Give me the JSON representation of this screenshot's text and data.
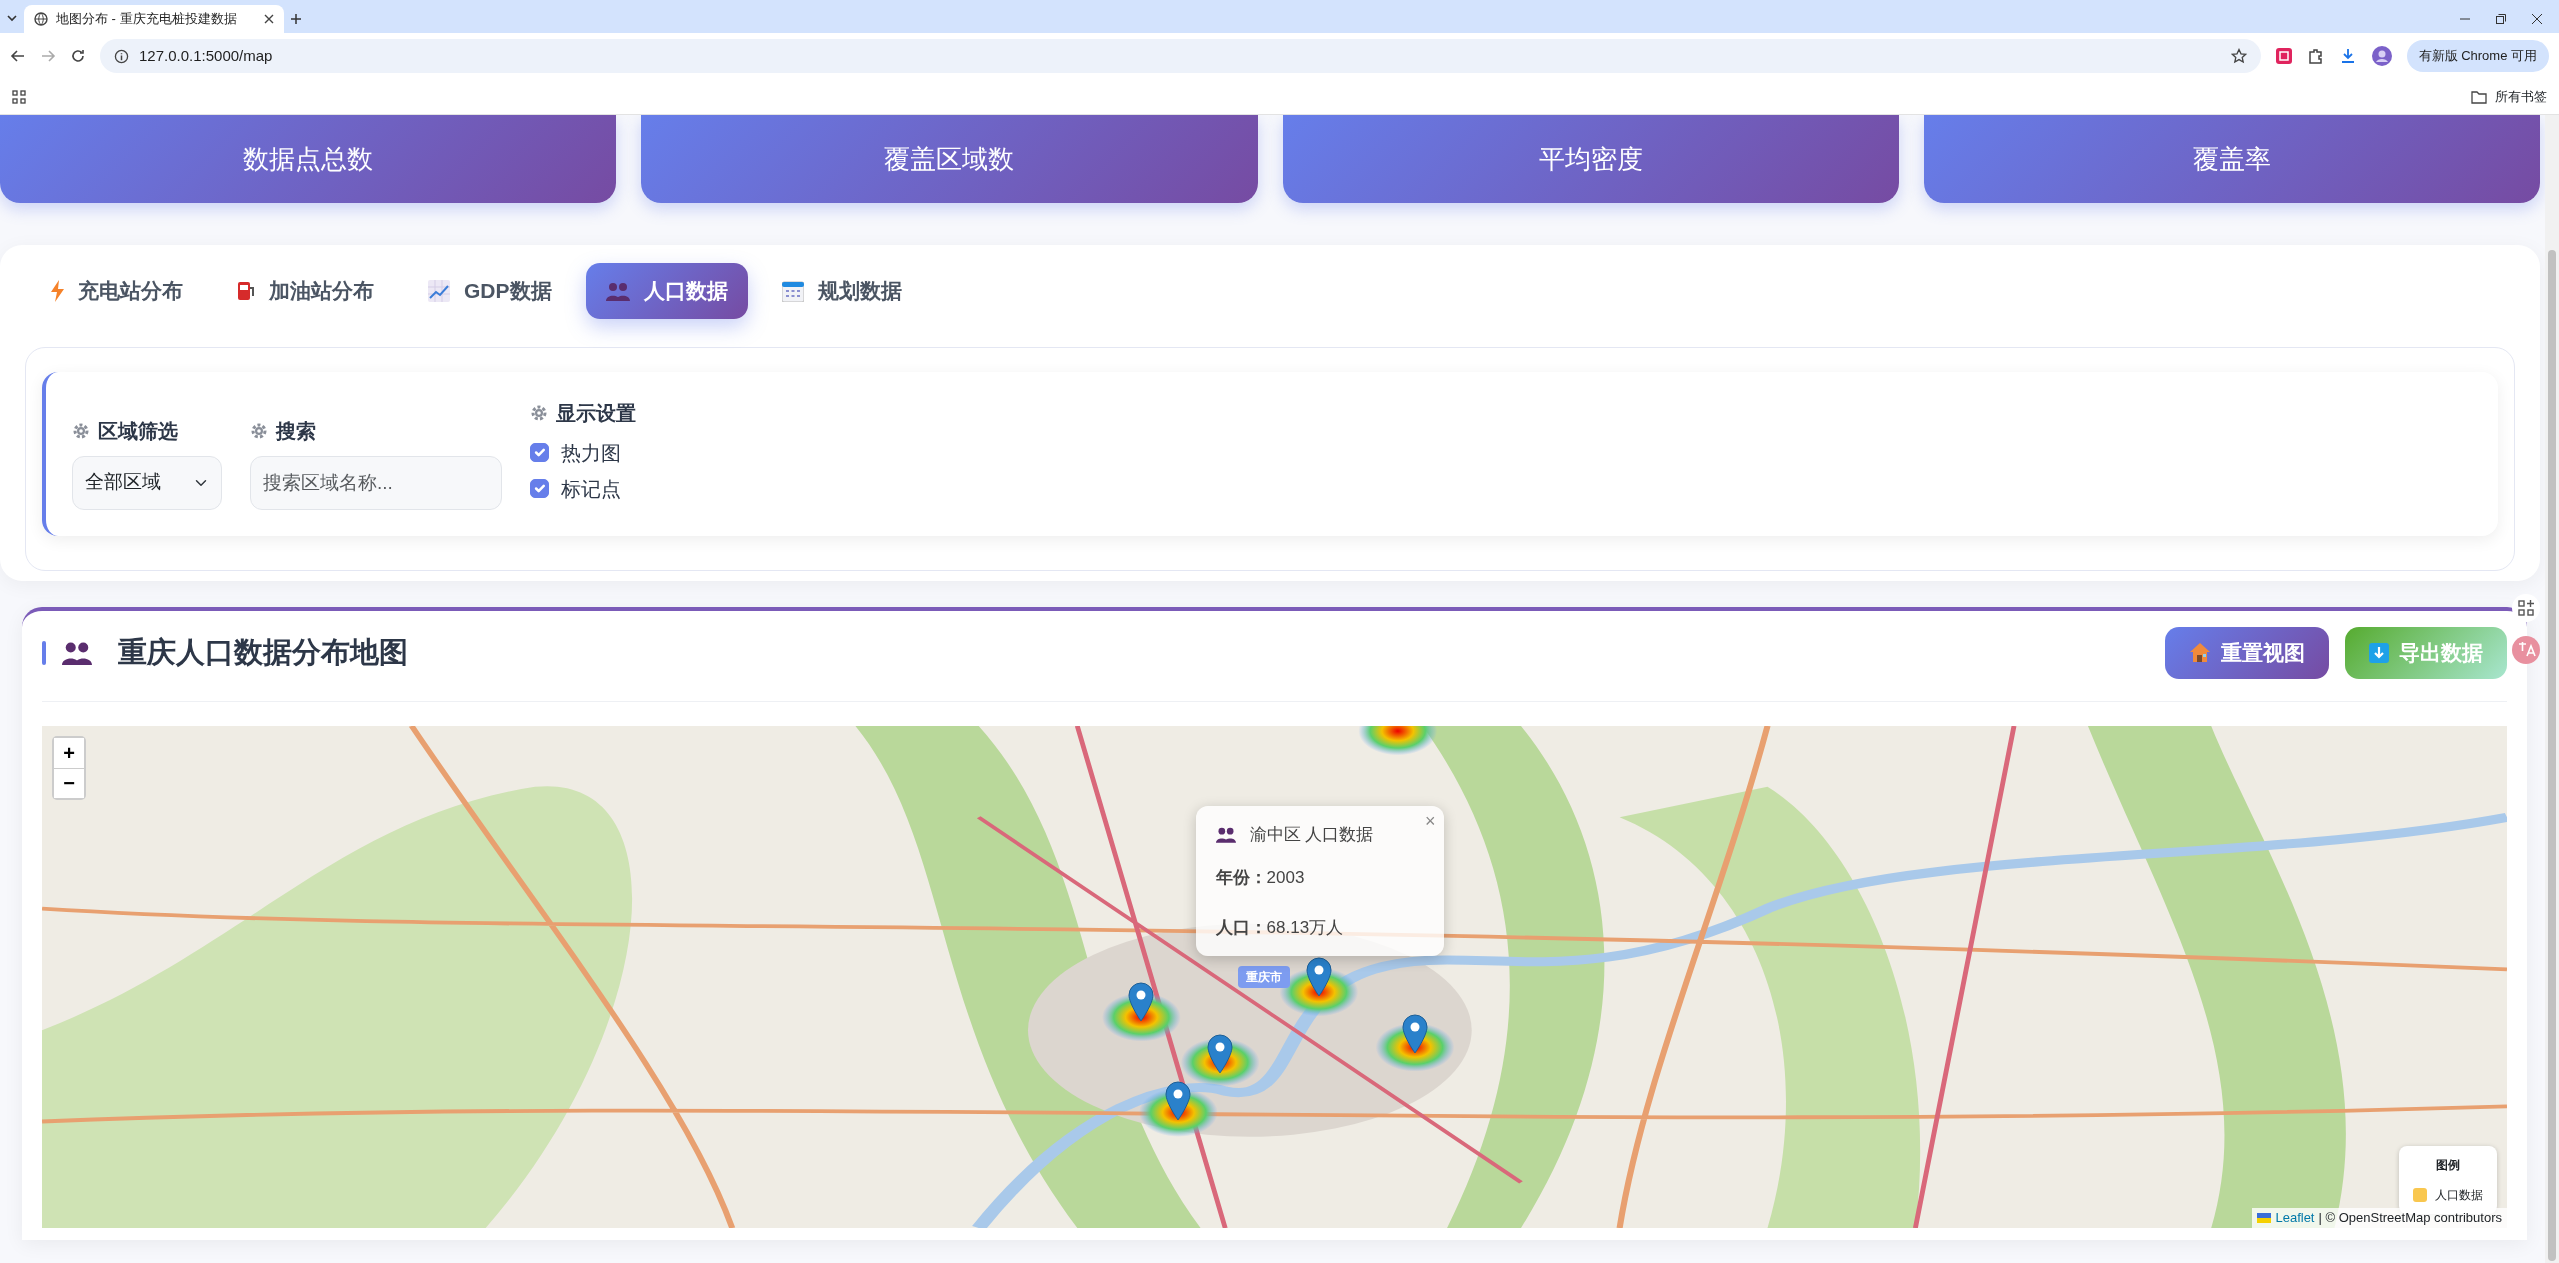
{
  "browser": {
    "tab_title": "地图分布 - 重庆充电桩投建数据",
    "url": "127.0.0.1:5000/map",
    "update_button": "有新版 Chrome 可用",
    "bookmarks_folder": "所有书签"
  },
  "stat_cards": [
    {
      "label": "数据点总数"
    },
    {
      "label": "覆盖区域数"
    },
    {
      "label": "平均密度"
    },
    {
      "label": "覆盖率"
    }
  ],
  "tabs": [
    {
      "label": "充电站分布",
      "kind": "bolt",
      "selected": false
    },
    {
      "label": "加油站分布",
      "kind": "fuel",
      "selected": false
    },
    {
      "label": "GDP数据",
      "kind": "chart",
      "selected": false
    },
    {
      "label": "人口数据",
      "kind": "people",
      "selected": true
    },
    {
      "label": "规划数据",
      "kind": "calendar",
      "selected": false
    }
  ],
  "filters": {
    "region": {
      "label": "区域筛选",
      "value": "全部区域"
    },
    "search": {
      "label": "搜索",
      "placeholder": "搜索区域名称..."
    },
    "display": {
      "label": "显示设置",
      "options": [
        {
          "label": "热力图",
          "checked": true
        },
        {
          "label": "标记点",
          "checked": true
        }
      ]
    }
  },
  "map_panel": {
    "title": "重庆人口数据分布地图",
    "buttons": [
      {
        "label": "重置视图",
        "kind": "reset"
      },
      {
        "label": "导出数据",
        "kind": "export"
      }
    ],
    "map": {
      "kind": "picture",
      "zoom_controls": [
        "+",
        "−"
      ],
      "popup": {
        "title": "渝中区 人口数据",
        "close": "×",
        "lines": [
          "**年份：**2003",
          "**人口：**68.13万人"
        ]
      },
      "marker_label": "重庆市",
      "legend": {
        "title": "图例",
        "items": [
          {
            "label": "人口数据",
            "color": "#f9c74f"
          }
        ]
      },
      "attribution": {
        "link": "Leaflet",
        "text": "| © OpenStreetMap contributors"
      }
    }
  }
}
